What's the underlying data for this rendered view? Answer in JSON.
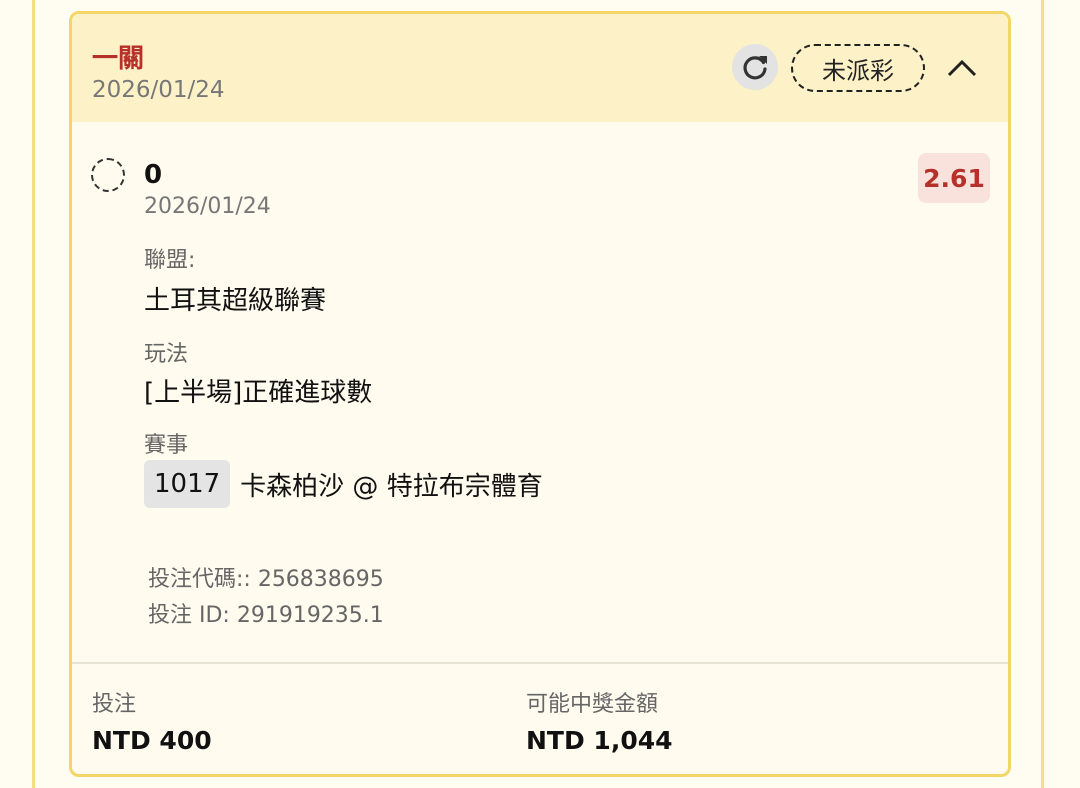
{
  "header": {
    "title": "一關",
    "date": "2026/01/24",
    "status": "未派彩"
  },
  "selection": {
    "name": "0",
    "date": "2026/01/24",
    "odds": "2.61",
    "league_label": "聯盟:",
    "league_value": "土耳其超級聯賽",
    "market_label": "玩法",
    "market_value": "[上半場]正確進球數",
    "event_label": "賽事",
    "event_code": "1017",
    "event_name": "卡森柏沙 @ 特拉布宗體育",
    "bet_code": "投注代碼:: 256838695",
    "bet_id": "投注 ID: 291919235.1"
  },
  "footer": {
    "stake_label": "投注",
    "stake_value": "NTD 400",
    "payout_label": "可能中獎金額",
    "payout_value": "NTD 1,044"
  },
  "icons": {
    "refresh": "refresh-icon",
    "collapse": "chevron-up-icon",
    "selection_status": "pending-circle-icon"
  },
  "colors": {
    "accent": "#b5312a",
    "header_bg": "#fdf1c7",
    "card_border": "#f2d768",
    "odds_bg": "#f9e2dc"
  }
}
